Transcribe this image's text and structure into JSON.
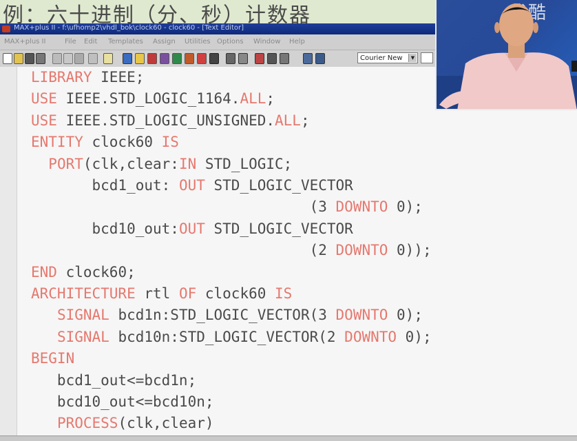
{
  "slide": {
    "title": "例：六十进制（分、秒）计数器"
  },
  "window": {
    "title": "MAX+plus II - f:\\ufhomp2\\vhdl_bok\\clock60 - clock60 - [Text Editor]"
  },
  "menu": {
    "items": [
      "MAX+plus II",
      "File",
      "Edit",
      "Templates",
      "Assign",
      "Utilities",
      "Options",
      "Window",
      "Help"
    ]
  },
  "toolbar": {
    "font_name": "Courier New",
    "icons": [
      "new-file-icon",
      "open-file-icon",
      "save-icon",
      "print-icon",
      "cut-icon",
      "copy-icon",
      "paste-icon",
      "undo-icon",
      "help-icon",
      "hierarchy-icon",
      "compile-icon",
      "simulate-icon",
      "timing-icon",
      "program-icon",
      "floorplan-icon",
      "graphic-editor-icon",
      "symbol-editor-icon",
      "text-editor-icon",
      "waveform-editor-icon",
      "project-save-check-icon",
      "project-save-compile-icon",
      "project-save-simulate-icon",
      "project-set-icon",
      "project-top-icon"
    ]
  },
  "watermark": "优酷",
  "code": {
    "lines": [
      [
        {
          "t": "LIBRARY",
          "k": true
        },
        {
          "t": " IEEE;"
        }
      ],
      [
        {
          "t": "USE",
          "k": true
        },
        {
          "t": " IEEE.STD_LOGIC_1164."
        },
        {
          "t": "ALL",
          "k": true
        },
        {
          "t": ";"
        }
      ],
      [
        {
          "t": "USE",
          "k": true
        },
        {
          "t": " IEEE.STD_LOGIC_UNSIGNED."
        },
        {
          "t": "ALL",
          "k": true
        },
        {
          "t": ";"
        }
      ],
      [
        {
          "t": "ENTITY",
          "k": true
        },
        {
          "t": " clock60 "
        },
        {
          "t": "IS",
          "k": true
        }
      ],
      [
        {
          "t": "  "
        },
        {
          "t": "PORT",
          "k": true
        },
        {
          "t": "(clk,clear:"
        },
        {
          "t": "IN",
          "k": true
        },
        {
          "t": " STD_LOGIC;"
        }
      ],
      [
        {
          "t": "       bcd1_out: "
        },
        {
          "t": "OUT",
          "k": true
        },
        {
          "t": " STD_LOGIC_VECTOR"
        }
      ],
      [
        {
          "t": "                                (3 "
        },
        {
          "t": "DOWNTO",
          "k": true
        },
        {
          "t": " 0);"
        }
      ],
      [
        {
          "t": "       bcd10_out:"
        },
        {
          "t": "OUT",
          "k": true
        },
        {
          "t": " STD_LOGIC_VECTOR"
        }
      ],
      [
        {
          "t": "                                (2 "
        },
        {
          "t": "DOWNTO",
          "k": true
        },
        {
          "t": " 0));"
        }
      ],
      [
        {
          "t": "END",
          "k": true
        },
        {
          "t": " clock60;"
        }
      ],
      [
        {
          "t": "ARCHITECTURE",
          "k": true
        },
        {
          "t": " rtl "
        },
        {
          "t": "OF",
          "k": true
        },
        {
          "t": " clock60 "
        },
        {
          "t": "IS",
          "k": true
        }
      ],
      [
        {
          "t": "   "
        },
        {
          "t": "SIGNAL",
          "k": true
        },
        {
          "t": " bcd1n:STD_LOGIC_VECTOR(3 "
        },
        {
          "t": "DOWNTO",
          "k": true
        },
        {
          "t": " 0);"
        }
      ],
      [
        {
          "t": "   "
        },
        {
          "t": "SIGNAL",
          "k": true
        },
        {
          "t": " bcd10n:STD_LOGIC_VECTOR(2 "
        },
        {
          "t": "DOWNTO",
          "k": true
        },
        {
          "t": " 0);"
        }
      ],
      [
        {
          "t": "BEGIN",
          "k": true
        }
      ],
      [
        {
          "t": "   bcd1_out<=bcd1n;"
        }
      ],
      [
        {
          "t": "   bcd10_out<=bcd10n;"
        }
      ],
      [
        {
          "t": "   "
        },
        {
          "t": "PROCESS",
          "k": true
        },
        {
          "t": "(clk,clear)"
        }
      ]
    ]
  },
  "colors": {
    "keyword": "#e5786e",
    "text": "#4a4a4a",
    "editor_bg": "#f6f6f6",
    "title_bar": "#1f3d99",
    "slide_title_bg": "#dfe9cf"
  }
}
